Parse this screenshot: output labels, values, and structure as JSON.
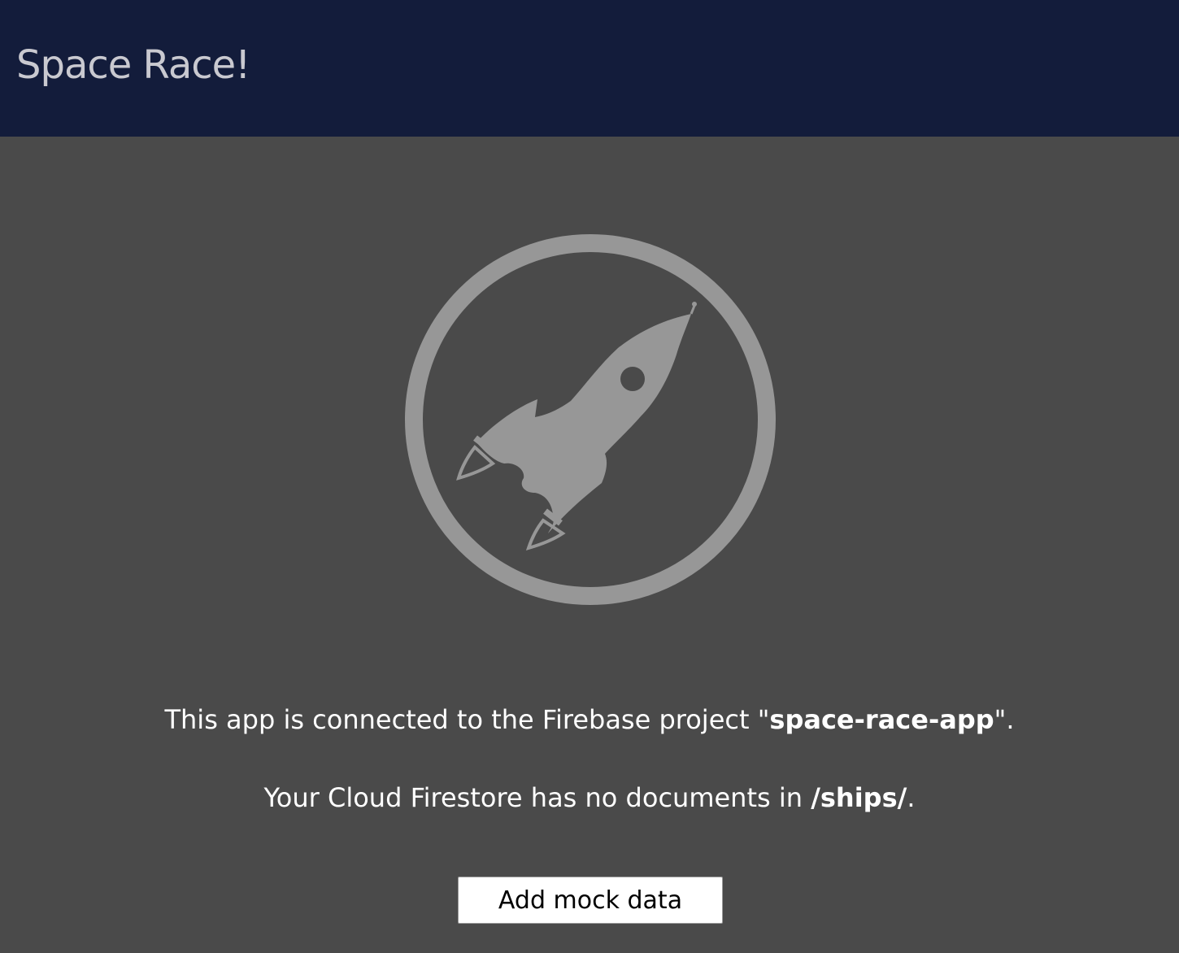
{
  "header": {
    "title": "Space Race!",
    "background": "#131c3b"
  },
  "main": {
    "background": "#4a4a4a",
    "logo_icon": "rocket-icon",
    "message_1": {
      "prefix": "This app is connected to the Firebase project \"",
      "project": "space-race-app",
      "suffix": "\"."
    },
    "message_2": {
      "prefix": "Your Cloud Firestore has no documents in ",
      "path": "/ships/",
      "suffix": "."
    },
    "add_button_label": "Add mock data"
  }
}
